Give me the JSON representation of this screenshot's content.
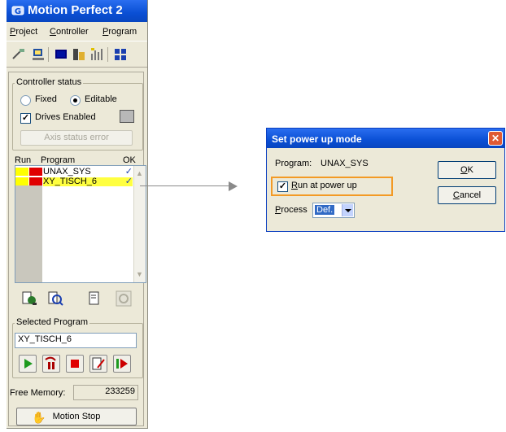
{
  "app": {
    "title": "Motion Perfect 2",
    "menu": [
      {
        "label_u": "P",
        "label_rest": "roject"
      },
      {
        "label_u": "C",
        "label_rest": "ontroller"
      },
      {
        "label_u": "P",
        "label_rest": "rogram"
      }
    ],
    "controller_status": {
      "label": "Controller status",
      "fixed_label": "Fixed",
      "editable_label": "Editable",
      "drives_enabled_label": "Drives Enabled",
      "axis_status_button": "Axis status error"
    },
    "program_list": {
      "col_run": "Run",
      "col_program": "Program",
      "col_ok": "OK",
      "rows": [
        {
          "name": "UNAX_SYS",
          "ok": "✓"
        },
        {
          "name": "XY_TISCH_6",
          "ok": "✓"
        }
      ]
    },
    "selected_program": {
      "label": "Selected Program",
      "value": "XY_TISCH_6"
    },
    "free_memory": {
      "label": "Free Memory:",
      "value": "233259"
    },
    "motion_stop": "Motion Stop"
  },
  "dialog": {
    "title": "Set power up mode",
    "program_label": "Program:",
    "program_value": "UNAX_SYS",
    "run_at_power_up_u": "R",
    "run_at_power_up_rest": "un at power up",
    "process_u": "P",
    "process_rest": "rocess",
    "process_value": "Def.",
    "ok_u": "O",
    "ok_rest": "K",
    "cancel_u": "C",
    "cancel_rest": "ancel",
    "close_glyph": "✕"
  },
  "colors": {
    "titlebar": "#0a4fd4",
    "run_yellow": "#ffff00",
    "run_red": "#e00000",
    "highlight_orange": "#f39a25",
    "selected_row": "#ffff40"
  }
}
